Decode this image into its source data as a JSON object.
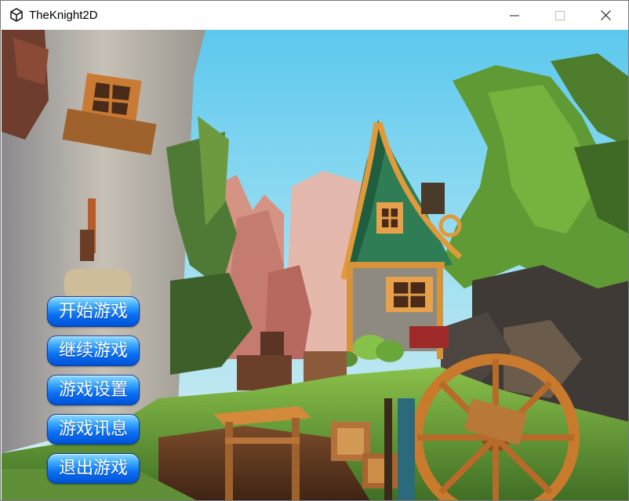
{
  "window": {
    "title": "TheKnight2D",
    "app_icon": "unity-logo-icon",
    "controls": {
      "minimize_icon": "minimize-icon",
      "maximize_icon": "maximize-icon",
      "close_icon": "close-icon"
    }
  },
  "menu": {
    "items": [
      {
        "label": "开始游戏"
      },
      {
        "label": "继续游戏"
      },
      {
        "label": "游戏设置"
      },
      {
        "label": "游戏讯息"
      },
      {
        "label": "退出游戏"
      }
    ]
  },
  "colors": {
    "sky": "#6fd0ee",
    "button_top": "#8fdcff",
    "button_bottom": "#0052d6",
    "button_text": "#ffffff",
    "grass": "#6fa43a",
    "roof": "#2f8a5a",
    "wood": "#c98a3c"
  }
}
